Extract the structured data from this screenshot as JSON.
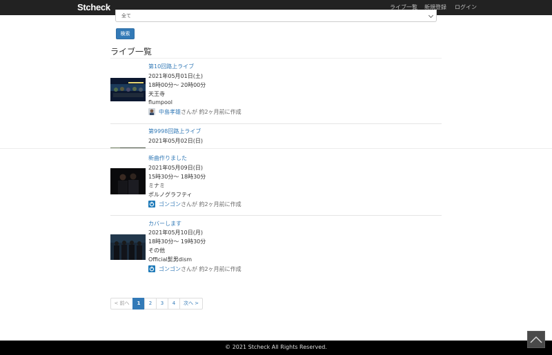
{
  "header": {
    "brand": "Stcheck",
    "nav": [
      "ライブ一覧",
      "新規登録",
      "ログイン"
    ]
  },
  "search": {
    "select_value": "全て",
    "button_label": "検索"
  },
  "section_title": "ライブ一覧",
  "lives": [
    {
      "title": "第10回路上ライブ",
      "date": "2021年05月01日(土)",
      "time": "18時00分〜 20時00分",
      "place": "天王寺",
      "artist": "flumpool",
      "author": "中島孝雄",
      "suffix": "さんが 約2ヶ月前に作成"
    },
    {
      "title": "第9998回路上ライブ",
      "date": "2021年05月02日(日)"
    },
    {
      "title": "新曲作りました",
      "date": "2021年05月09日(日)",
      "time": "15時30分〜 18時30分",
      "place": "ミナミ",
      "artist": "ポルノグラフティ",
      "author": "ゴンゴン",
      "suffix": "さんが 約2ヶ月前に作成"
    },
    {
      "title": "カバーします",
      "date": "2021年05月10日(月)",
      "time": "18時30分〜 19時30分",
      "place": "その他",
      "artist": "Official髭男dism",
      "author": "ゴンゴン",
      "suffix": "さんが 約2ヶ月前に作成"
    }
  ],
  "pagination": {
    "prev": "< 前へ",
    "pages": [
      "1",
      "2",
      "3",
      "4"
    ],
    "current": "1",
    "next": "次へ >"
  },
  "footer": "© 2021 Stcheck All Rights Reserved.",
  "colors": {
    "navbar": "#222222",
    "link": "#337ab7",
    "footer": "#000000"
  }
}
